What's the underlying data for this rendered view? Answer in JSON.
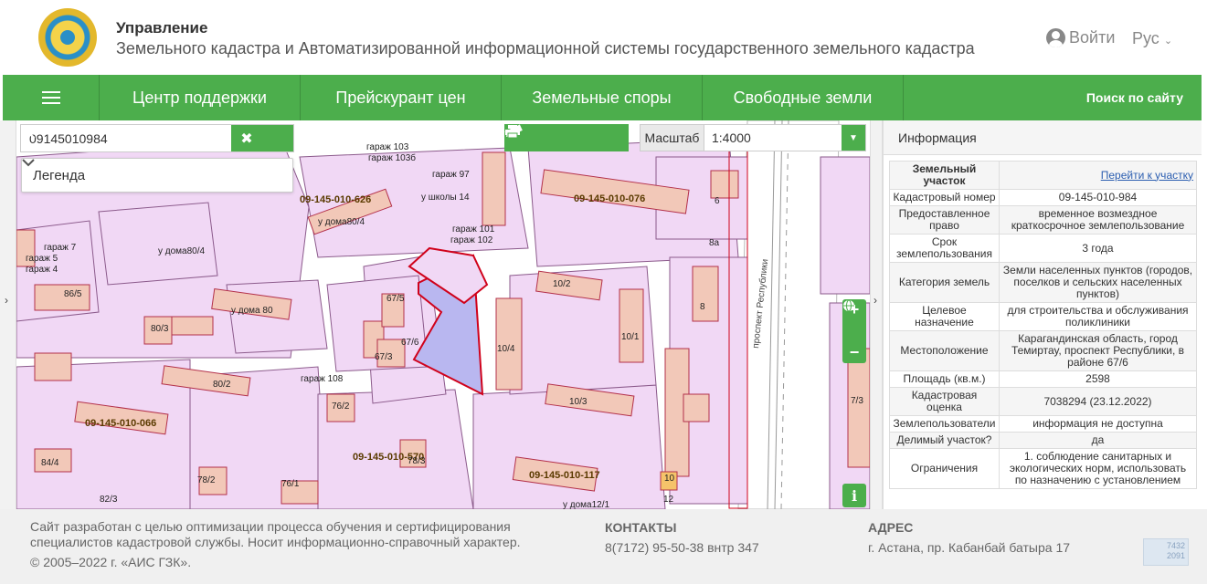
{
  "header": {
    "title": "Управление",
    "subtitle": "Земельного кадастра и Автоматизированной информационной системы государственного земельного кадастра",
    "login_label": "Войти",
    "language": "Рус"
  },
  "nav": {
    "items": [
      "Центр поддержки",
      "Прейскурант цен",
      "Земельные споры",
      "Свободные земли"
    ],
    "search_label": "Поиск по сайту"
  },
  "map": {
    "search_value": "09145010984",
    "legend_label": "Легенда",
    "scale_label": "Масштаб",
    "scale_value": "1:4000",
    "labels": [
      {
        "text": "09-145-010-626"
      },
      {
        "text": "09-145-010-076"
      },
      {
        "text": "09-145-010-066"
      },
      {
        "text": "09-145-010-570"
      },
      {
        "text": "09-145-010-117"
      },
      {
        "text": "гараж 103"
      },
      {
        "text": "гараж 103б"
      },
      {
        "text": "гараж 97"
      },
      {
        "text": "у школы 14"
      },
      {
        "text": "у дома80/4"
      },
      {
        "text": "гараж 101"
      },
      {
        "text": "гараж 102"
      },
      {
        "text": "у дома 80"
      },
      {
        "text": "80/2"
      },
      {
        "text": "10/2"
      },
      {
        "text": "10/4"
      },
      {
        "text": "10/3"
      },
      {
        "text": "10/1"
      },
      {
        "text": "86/5"
      },
      {
        "text": "80/3"
      },
      {
        "text": "84/4"
      },
      {
        "text": "78/2"
      },
      {
        "text": "76/1"
      },
      {
        "text": "82/3"
      },
      {
        "text": "67/5"
      },
      {
        "text": "67/6"
      },
      {
        "text": "67/3"
      },
      {
        "text": "76/2"
      },
      {
        "text": "78/3"
      },
      {
        "text": "гараж 108"
      },
      {
        "text": "гараж 7"
      },
      {
        "text": "гараж 5"
      },
      {
        "text": "гараж 4"
      },
      {
        "text": "у дома80/4"
      },
      {
        "text": "у дома12/1"
      },
      {
        "text": "проспект Республики"
      },
      {
        "text": "8"
      },
      {
        "text": "8а"
      },
      {
        "text": "6"
      },
      {
        "text": "10"
      },
      {
        "text": "7/3"
      },
      {
        "text": "12"
      }
    ]
  },
  "panel": {
    "title": "Информация",
    "table_title": "Земельный участок",
    "goto_link": "Перейти к участку",
    "rows": [
      {
        "k": "Кадастровый номер",
        "v": "09-145-010-984"
      },
      {
        "k": "Предоставленное право",
        "v": "временное возмездное краткосрочное землепользование"
      },
      {
        "k": "Срок землепользования",
        "v": "3 года"
      },
      {
        "k": "Категория земель",
        "v": "Земли населенных пунктов (городов, поселков и сельских населенных пунктов)"
      },
      {
        "k": "Целевое назначение",
        "v": "для строительства и обслуживания поликлиники"
      },
      {
        "k": "Местоположение",
        "v": "Карагандинская область, город Темиртау, проспект Республики, в районе 67/6"
      },
      {
        "k": "Площадь (кв.м.)",
        "v": "2598"
      },
      {
        "k": "Кадастровая оценка",
        "v": "7038294 (23.12.2022)"
      },
      {
        "k": "Землепользователи",
        "v": "информация не доступна"
      },
      {
        "k": "Делимый участок?",
        "v": "да"
      },
      {
        "k": "Ограничения",
        "v": "1. соблюдение санитарных и экологических норм, использовать по назначению с установлением"
      }
    ]
  },
  "footer": {
    "about": "Сайт разработан с целью оптимизации процесса обучения и сертифицирования специалистов кадастровой службы. Носит информационно-справочный характер.",
    "copyright": "© 2005–2022 г. «АИС ГЗК».",
    "contacts_title": "КОНТАКТЫ",
    "contacts_phone": "8(7172) 95-50-38 внтр 347",
    "address_title": "АДРЕС",
    "address_text": "г. Астана, пр. Кабанбай батыра 17",
    "counter_top": "7432",
    "counter_bottom": "2091"
  },
  "colors": {
    "accent": "#4cae4c",
    "parcel_fill": "#f1d8f5",
    "building_fill": "#f2c8b8",
    "selected_fill": "#b9b7f0",
    "boundary": "#d0021b"
  }
}
